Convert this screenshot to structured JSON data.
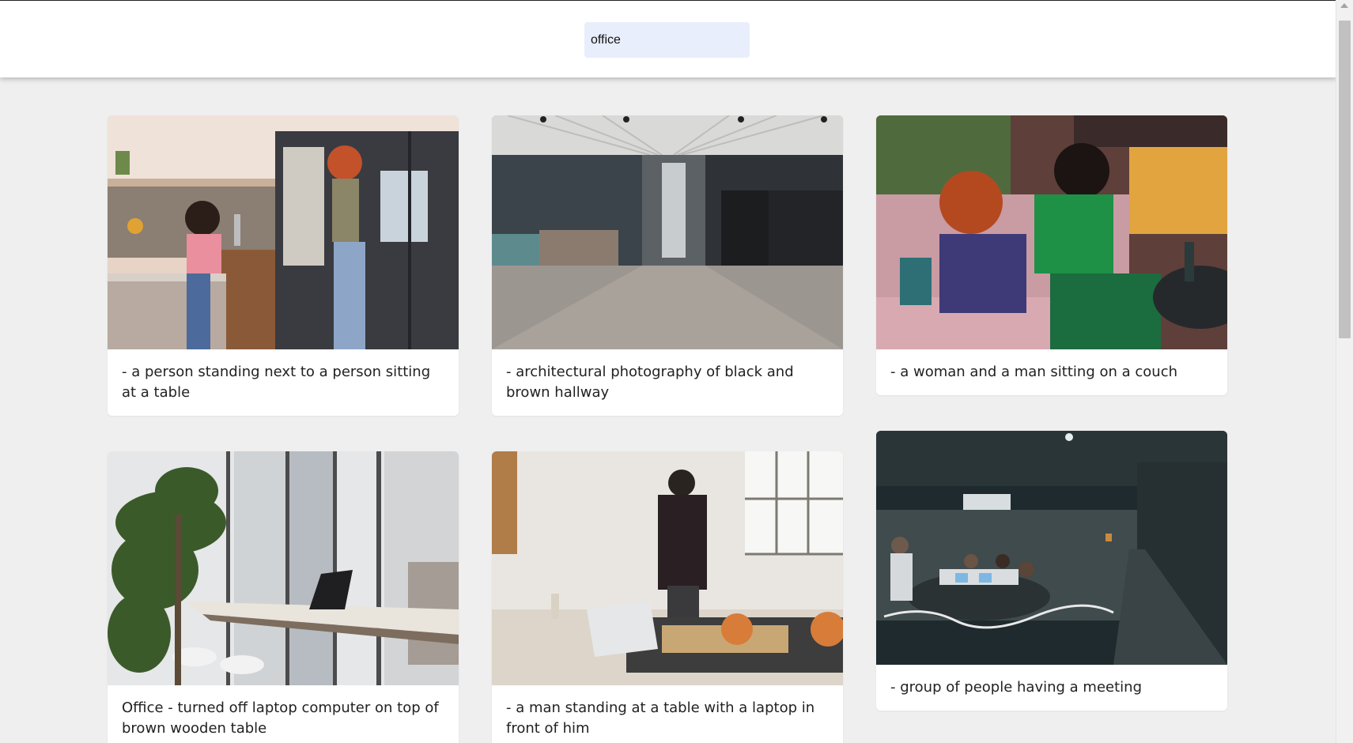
{
  "search": {
    "value": "office",
    "placeholder": ""
  },
  "photos": [
    {
      "caption": "- a person standing next to a person sitting at a table"
    },
    {
      "caption": "- architectural photography of black and brown hallway"
    },
    {
      "caption": "- a woman and a man sitting on a couch"
    },
    {
      "caption": "Office - turned off laptop computer on top of brown wooden table"
    },
    {
      "caption": "- a man standing at a table with a laptop in front of him"
    },
    {
      "caption": "- group of people having a meeting"
    }
  ]
}
